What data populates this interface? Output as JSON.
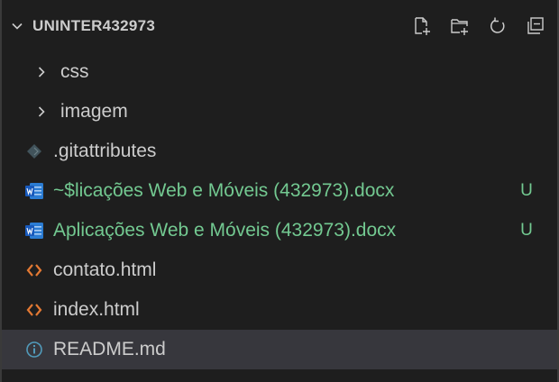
{
  "explorer": {
    "section_title": "UNINTER432973",
    "actions": [
      {
        "name": "new-file-icon"
      },
      {
        "name": "new-folder-icon"
      },
      {
        "name": "refresh-icon"
      },
      {
        "name": "collapse-all-icon"
      }
    ],
    "items": [
      {
        "label": "css",
        "kind": "folder",
        "icon": "chevron-right-icon"
      },
      {
        "label": "imagem",
        "kind": "folder",
        "icon": "chevron-right-icon"
      },
      {
        "label": ".gitattributes",
        "kind": "file",
        "icon": "git-diamond-icon"
      },
      {
        "label": "~$licações Web e Móveis (432973).docx",
        "kind": "file",
        "icon": "word-doc-icon",
        "badge": "U"
      },
      {
        "label": "Aplicações Web e Móveis (432973).docx",
        "kind": "file",
        "icon": "word-doc-icon",
        "badge": "U"
      },
      {
        "label": "contato.html",
        "kind": "file",
        "icon": "html-icon"
      },
      {
        "label": "index.html",
        "kind": "file",
        "icon": "html-icon"
      },
      {
        "label": "README.md",
        "kind": "file",
        "icon": "info-icon",
        "selected": true
      }
    ]
  },
  "colors": {
    "background": "#1e1e1e",
    "text": "#cccccc",
    "untracked": "#73c991",
    "html_icon": "#e37933",
    "word_icon": "#2b7cd3",
    "info_icon": "#519aba",
    "selected_row": "#37373d"
  }
}
